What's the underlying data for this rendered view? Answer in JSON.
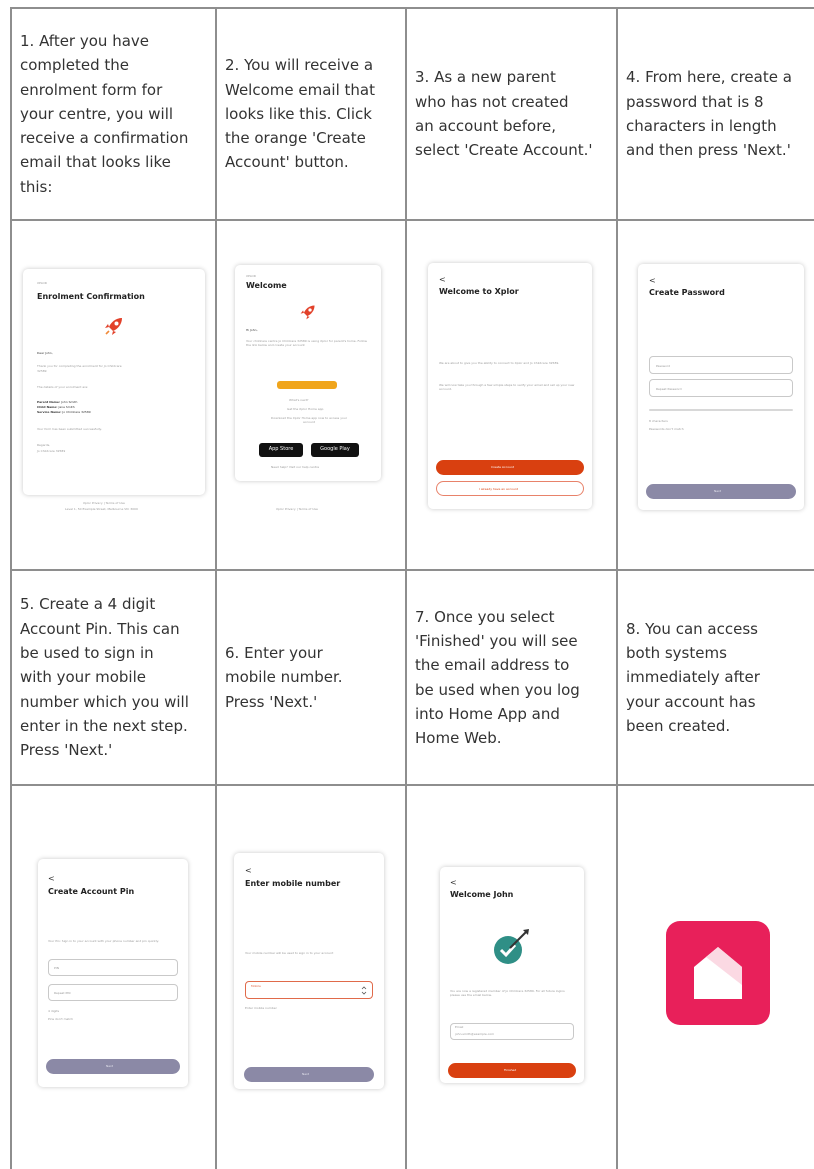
{
  "steps": [
    {
      "lines": [
        "1. After you have",
        "completed the",
        "enrolment form for",
        "your centre, you will",
        "receive a confirmation",
        "email that looks like",
        "this:"
      ],
      "screen": {
        "heading_small": "XPLOR",
        "title": "Enrolment Confirmation",
        "greeting": "Dear John,",
        "body1": "Thank you for completing the enrolment for Jo Childcare",
        "body2": "32589",
        "details_intro": "The details of your enrolment are:",
        "parent_label": "Parent Name:",
        "parent_value": "John Smith",
        "child_label": "Child Name:",
        "child_value": "Jane Smith",
        "service_label": "Service Name:",
        "service_value": "Jo Childcare 32589",
        "submitted": "Your form has been submitted successfully.",
        "regards": "Regards,",
        "sign": "Jo Childcare 32589",
        "footer1": "Xplor Privacy | Terms of Use",
        "footer2": "Level 1, 50 Example Street, Melbourne VIC 3000"
      }
    },
    {
      "lines": [
        "2. You will receive a",
        "Welcome email that",
        "looks like this. Click",
        "the orange 'Create",
        "Account' button."
      ],
      "screen": {
        "heading_small": "XPLOR",
        "title": "Welcome",
        "greeting": "Hi John,",
        "body": "Your childcare centre Jo Childcare 32589 is using Xplor for parent's home. Follow the link below and create your account",
        "button": "Create Account",
        "whats_next": "What's next?",
        "next_sub": "Get the Xplor Home app",
        "download": "Download the Xplor Home app now to access your account",
        "app_store": "App Store",
        "google_play": "Google Play",
        "footer_a": "Need help? Visit our help centre",
        "footer_b": "Xplor Privacy | Terms of Use"
      }
    },
    {
      "lines": [
        "3. As a new parent",
        "who has not created",
        "an account before,",
        "select 'Create Account.'"
      ],
      "screen": {
        "back": "<",
        "title": "Welcome to Xplor",
        "para1": "We are about to give you the ability to connect to Xplor and Jo Childcare 32589.",
        "para2": "We will now take you through a few simple steps to verify your email and set up your new account.",
        "primary": "Create Account",
        "secondary": "I already have an account"
      }
    },
    {
      "lines": [
        "4. From here, create a",
        "password that is 8",
        "characters in length",
        "and then press 'Next.'"
      ],
      "screen": {
        "back": "<",
        "title": "Create Password",
        "field1": "Password",
        "field2": "Repeat Password",
        "hint1": "8 characters",
        "hint2": "Passwords don't match",
        "button": "Next"
      }
    },
    {
      "lines": [
        "5. Create a 4 digit",
        "Account Pin. This can",
        "be used to sign in",
        "with your mobile",
        "number which you will",
        "enter in the next step.",
        "Press 'Next.'"
      ],
      "screen": {
        "back": "<",
        "title": "Create Account Pin",
        "desc": "Your Pin: Sign in to your account with your phone number and pin quickly.",
        "field1": "PIN",
        "field2": "Repeat PIN",
        "hint1": "4 digits",
        "hint2": "Pins don't match",
        "button": "Next"
      }
    },
    {
      "lines": [
        "6. Enter your",
        "mobile number.",
        "Press 'Next.'"
      ],
      "screen": {
        "back": "<",
        "title": "Enter mobile number",
        "desc": "Your mobile number will be used to sign in to your account",
        "field_label": "Mobile",
        "hint": "Enter mobile number",
        "button": "Next"
      }
    },
    {
      "lines": [
        "7. Once you select",
        "'Finished' you will see",
        "the email address to",
        "be used when you log",
        "into Home App and",
        "Home Web."
      ],
      "screen": {
        "back": "<",
        "title": "Welcome John",
        "desc": "You are now a registered member of Jo Childcare 32589. For all future logins please use the email below.",
        "field_label": "Email",
        "field_value": "john.smith@example.com",
        "button": "Finished"
      }
    },
    {
      "lines": [
        "8. You can access",
        "both systems",
        "immediately after",
        "your account has",
        "been created."
      ]
    }
  ],
  "colors": {
    "border": "#8e8e8e",
    "orange": "#d94010",
    "grey_button": "#8b89a6",
    "icon_pink": "#e8205a"
  }
}
